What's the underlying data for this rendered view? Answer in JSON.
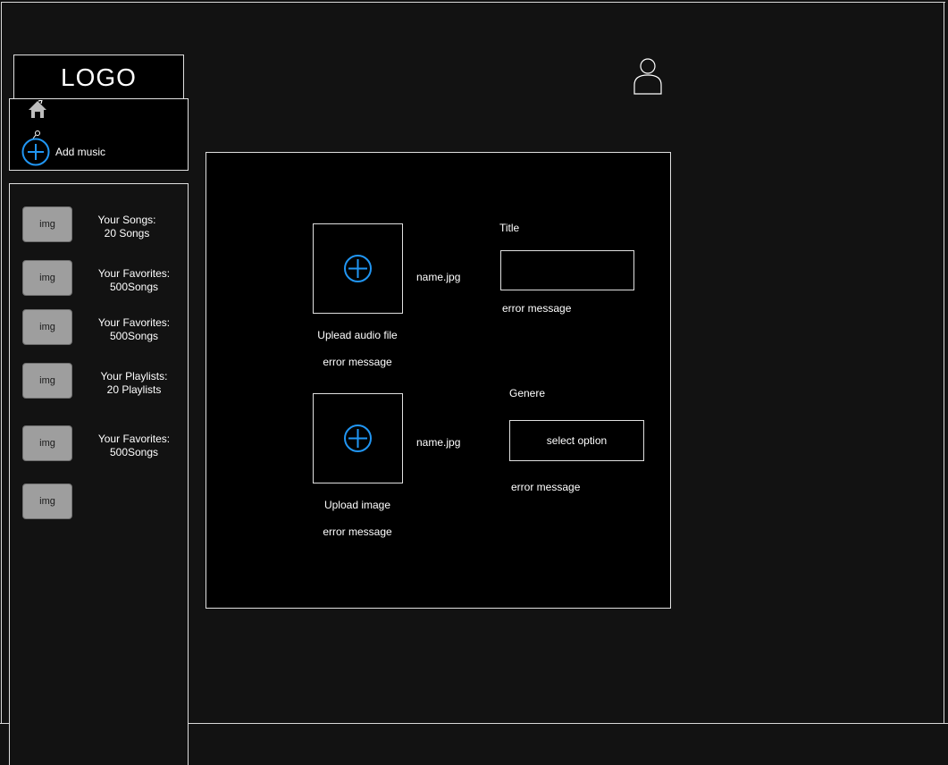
{
  "header": {
    "logo_text": "LOGO",
    "user_icon": "user-icon"
  },
  "nav": {
    "home_icon": "home-icon",
    "add_music": {
      "icon": "add-circle-icon",
      "label": "Add music"
    }
  },
  "library": {
    "items": [
      {
        "thumb": "img",
        "line1": "Your Songs:",
        "line2": "20 Songs"
      },
      {
        "thumb": "img",
        "line1": "Your Favorites:",
        "line2": "500Songs"
      },
      {
        "thumb": "img",
        "line1": "Your Favorites:",
        "line2": "500Songs"
      },
      {
        "thumb": "img",
        "line1": "Your Playlists:",
        "line2": "20 Playlists"
      },
      {
        "thumb": "img",
        "line1": "Your Favorites:",
        "line2": "500Songs"
      },
      {
        "thumb": "img",
        "line1": "",
        "line2": ""
      }
    ]
  },
  "form": {
    "audio_upload": {
      "icon": "add-circle-icon",
      "filename": "name.jpg",
      "label": "Uplead audio file",
      "error": "error message"
    },
    "image_upload": {
      "icon": "add-circle-icon",
      "filename": "name.jpg",
      "label": "Upload image",
      "error": "error message"
    },
    "title_field": {
      "label": "Title",
      "value": "",
      "error": "error message"
    },
    "genre_field": {
      "label": "Genere",
      "selected": "select option",
      "error": "error message"
    }
  },
  "colors": {
    "background": "#121212",
    "panel": "#000000",
    "border": "#e0e0e0",
    "accent": "#2196f3",
    "thumb": "#9e9e9e"
  }
}
